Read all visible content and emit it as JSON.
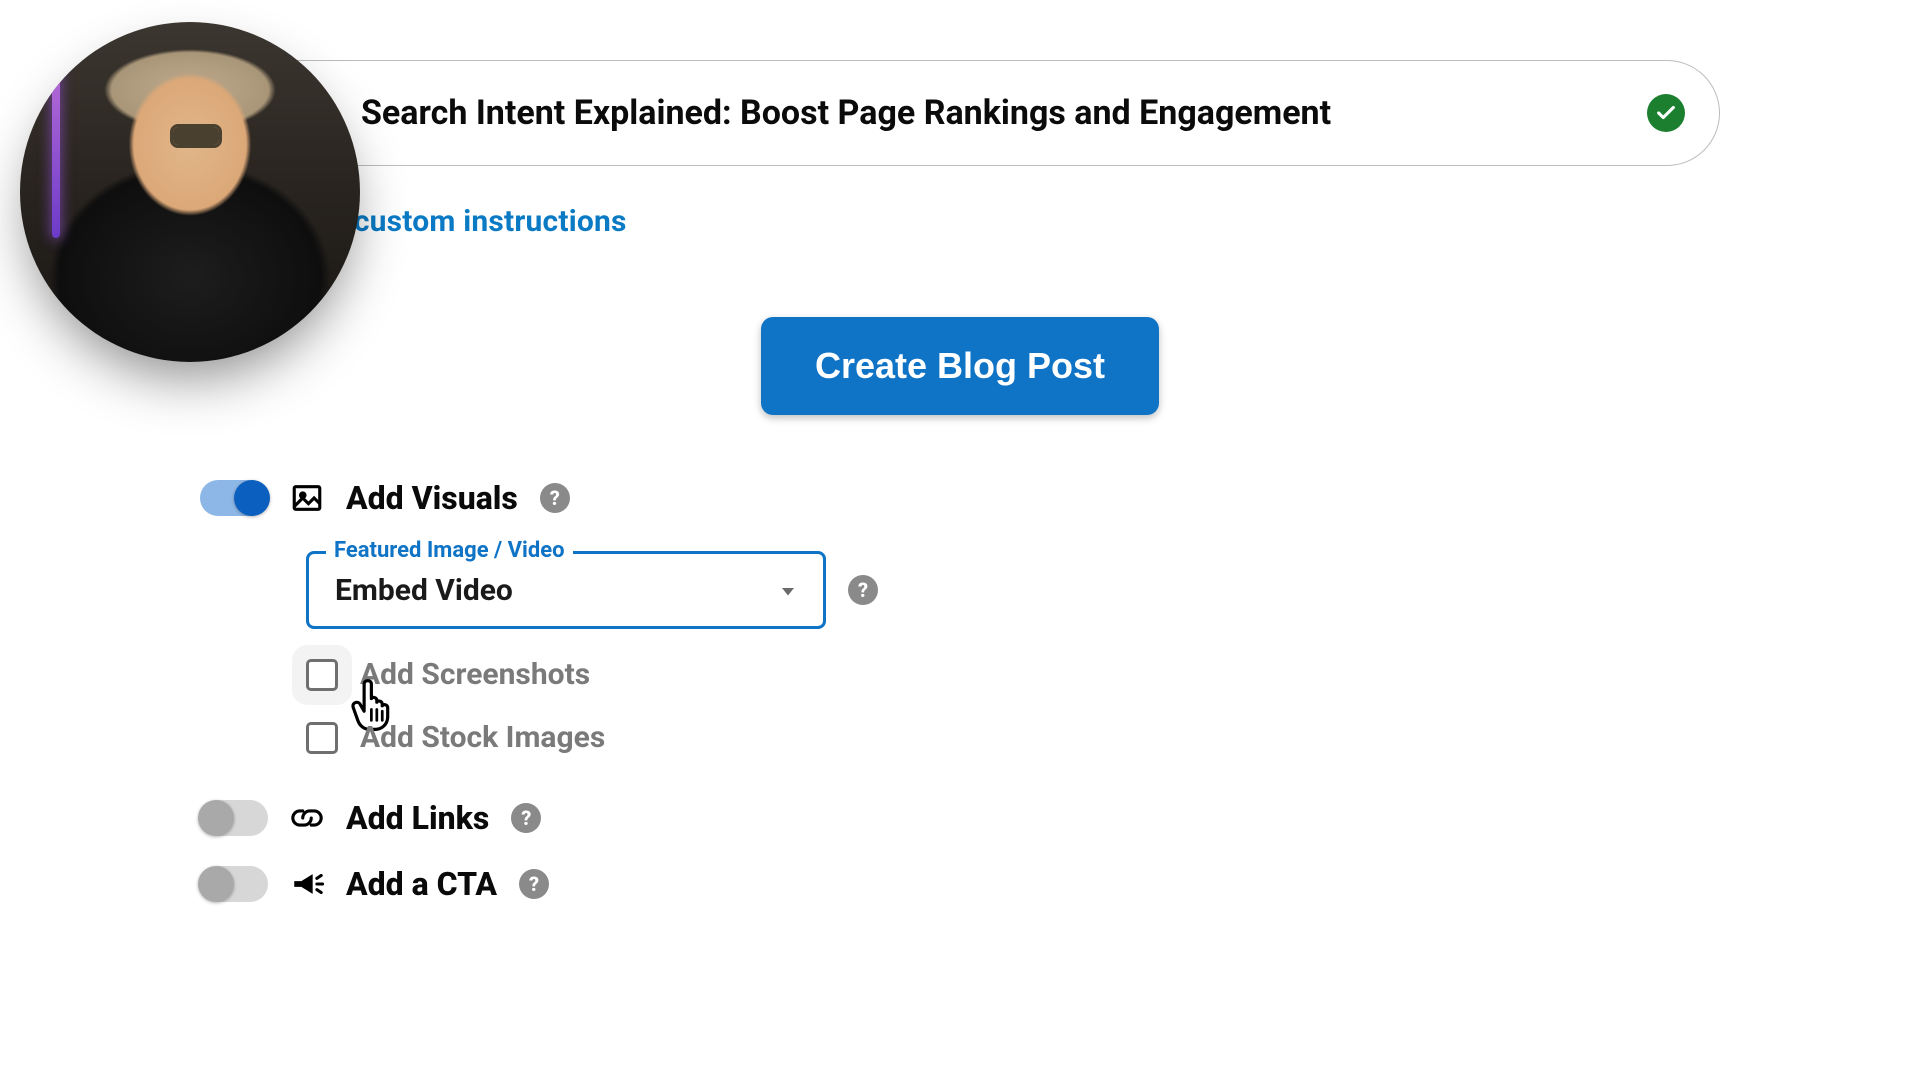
{
  "title_field": {
    "value": "Search Intent Explained: Boost Page Rankings and Engagement",
    "validated": true
  },
  "custom_instructions_link_fragment": "r custom instructions",
  "create_button_label": "Create Blog Post",
  "options": {
    "visuals": {
      "label": "Add Visuals",
      "enabled": true,
      "featured": {
        "field_label": "Featured Image / Video",
        "selected": "Embed Video"
      },
      "screenshots": {
        "label": "Add Screenshots",
        "checked": false
      },
      "stock": {
        "label": "Add Stock Images",
        "checked": false
      }
    },
    "links": {
      "label": "Add Links",
      "enabled": false
    },
    "cta": {
      "label": "Add a CTA",
      "enabled": false
    }
  },
  "help_glyph": "?"
}
